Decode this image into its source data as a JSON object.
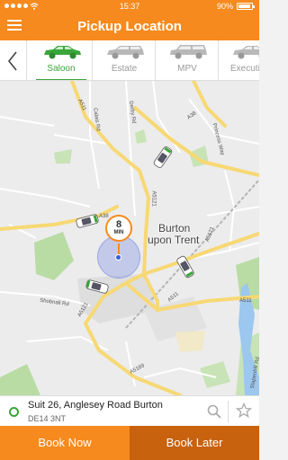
{
  "status_bar": {
    "time": "15:37",
    "battery": "90%",
    "battery_level": 0.9
  },
  "app_bar": {
    "title": "Pickup Location",
    "menu_icon": "hamburger-menu-icon"
  },
  "vehicles": [
    {
      "label": "Saloon",
      "selected": true
    },
    {
      "label": "Estate",
      "selected": false
    },
    {
      "label": "MPV",
      "selected": false
    },
    {
      "label": "Executive",
      "selected": false
    }
  ],
  "map": {
    "town": [
      "Burton",
      "upon Trent"
    ],
    "roads": {
      "a511_north": "A511",
      "a38": "A38",
      "a38_west": "A38",
      "a5121_centre": "A5121",
      "a5121_east": "A5121",
      "a511_east": "A511",
      "a511_south": "A511",
      "a5121_south": "A5121",
      "a5189": "A5189",
      "calais_rd": "Calais Rd",
      "derby_rd": "Derby Rd",
      "shobnall_rd": "Shobnall Rd",
      "princess_way": "Princess Way",
      "stapenhill_rd": "Stapenhill Rd"
    },
    "eta": {
      "value": "8",
      "unit": "MIN"
    }
  },
  "address": {
    "line1": "Suit 26, Anglesey Road Burton",
    "line2": "DE14 3NT"
  },
  "actions": {
    "book_now": "Book Now",
    "book_later": "Book Later"
  },
  "colors": {
    "brand_orange": "#f68a1e",
    "dark_orange": "#c8620f",
    "selected_green": "#3aa63a",
    "location_blue": "#2e5fe0"
  }
}
